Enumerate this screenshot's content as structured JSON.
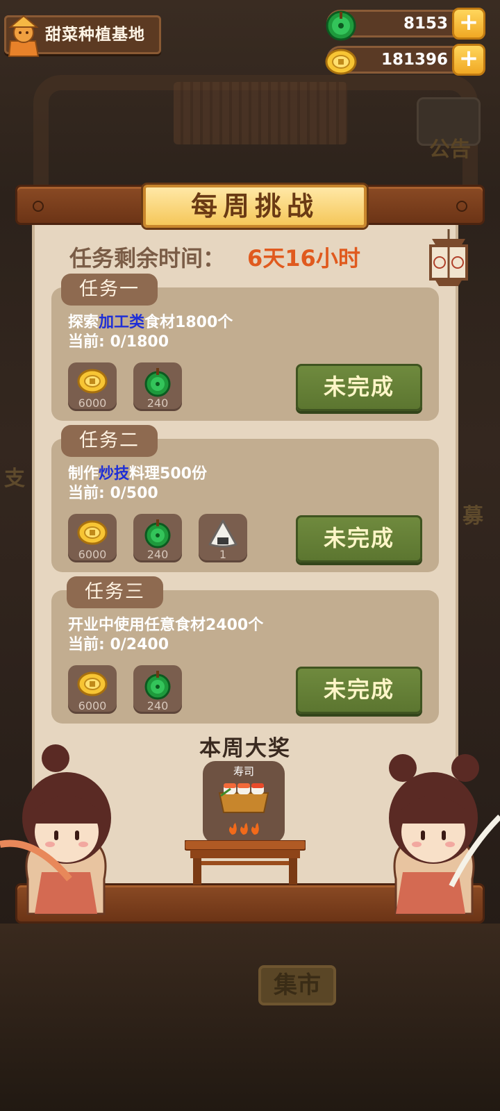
{
  "hud": {
    "location": "甜菜种植基地",
    "jade": {
      "icon": "jade-coin-icon",
      "value": "8153",
      "plus": "+"
    },
    "gold": {
      "icon": "gold-coin-icon",
      "value": "181396",
      "plus": "+"
    }
  },
  "background": {
    "notice": "公告",
    "market_sign": "集市",
    "side_left": "支",
    "side_right": "募"
  },
  "panel": {
    "title": "每周挑战",
    "time_label": "任务剩余时间：",
    "time_value": "6天16小时",
    "tasks": [
      {
        "tab": "任务一",
        "desc_pre": "探索",
        "desc_hl": "加工类",
        "desc_post": "食材1800个",
        "progress": "当前: 0/1800",
        "rewards": [
          {
            "icon": "gold-coin-icon",
            "amount": "6000"
          },
          {
            "icon": "jade-coin-icon",
            "amount": "240"
          }
        ],
        "status": "未完成"
      },
      {
        "tab": "任务二",
        "desc_pre": "制作",
        "desc_hl": "炒技",
        "desc_post": "料理500份",
        "progress": "当前: 0/500",
        "rewards": [
          {
            "icon": "gold-coin-icon",
            "amount": "6000"
          },
          {
            "icon": "jade-coin-icon",
            "amount": "240"
          },
          {
            "icon": "rice-ball-icon",
            "amount": "1"
          }
        ],
        "status": "未完成"
      },
      {
        "tab": "任务三",
        "desc_pre": "开业中使用任意食材2400个",
        "desc_hl": "",
        "desc_post": "",
        "progress": "当前: 0/2400",
        "rewards": [
          {
            "icon": "gold-coin-icon",
            "amount": "6000"
          },
          {
            "icon": "jade-coin-icon",
            "amount": "240"
          }
        ],
        "status": "未完成"
      }
    ],
    "prize": {
      "title": "本周大奖",
      "name": "寿司",
      "icon": "sushi-icon",
      "rating_icon": "flame-icon",
      "flames": 3
    }
  },
  "colors": {
    "accent_orange": "#e05a1e",
    "highlight_blue": "#1f2fd6",
    "button_green": "#6f8a3e",
    "panel_bg": "#e6d6c0"
  }
}
